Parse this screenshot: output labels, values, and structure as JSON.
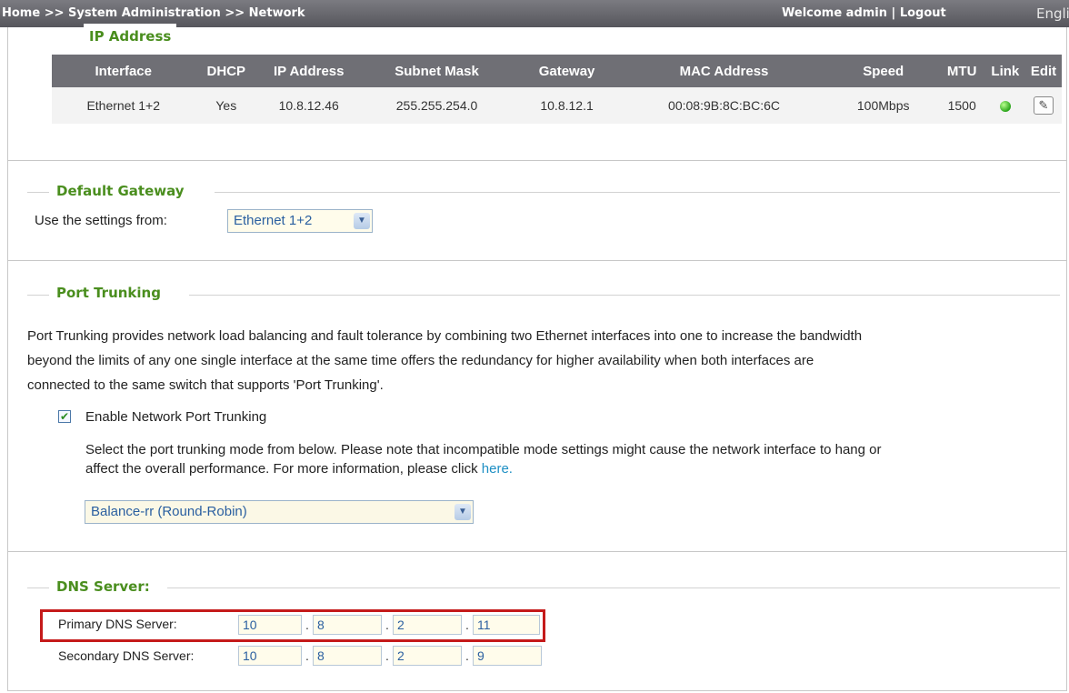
{
  "topbar": {
    "breadcrumb": [
      "Home",
      "System Administration",
      "Network"
    ],
    "separator": ">>",
    "welcome": "Welcome admin",
    "divider": "|",
    "logout": "Logout",
    "language": "English"
  },
  "ip_address": {
    "legend": "IP Address",
    "columns": [
      "Interface",
      "DHCP",
      "IP Address",
      "Subnet Mask",
      "Gateway",
      "MAC Address",
      "Speed",
      "MTU",
      "Link",
      "Edit"
    ],
    "row": {
      "interface": "Ethernet 1+2",
      "dhcp": "Yes",
      "ip": "10.8.12.46",
      "subnet": "255.255.254.0",
      "gateway": "10.8.12.1",
      "mac": "00:08:9B:8C:BC:6C",
      "speed": "100Mbps",
      "mtu": "1500",
      "link_status": "up",
      "link_color": "#2aa51a",
      "edit_icon": "edit-icon"
    }
  },
  "default_gateway": {
    "legend": "Default Gateway",
    "label": "Use the settings from:",
    "selected": "Ethernet 1+2"
  },
  "port_trunking": {
    "legend": "Port Trunking",
    "description_1": "Port Trunking provides network load balancing and fault tolerance by combining two Ethernet interfaces into one to increase the bandwidth",
    "description_2": "beyond the limits of any one single interface at the same time offers the redundancy for higher availability when both interfaces are",
    "description_3": "connected to the same switch that supports 'Port Trunking'.",
    "enable_label": "Enable Network Port Trunking",
    "enable_checked": true,
    "mode_text_1": "Select the port trunking mode from below. Please note that incompatible mode settings might cause the network interface to hang or",
    "mode_text_2": "affect the overall performance. For more information, please click",
    "here_link": "here.",
    "mode_selected": "Balance-rr (Round-Robin)"
  },
  "dns": {
    "legend": "DNS Server:",
    "primary_label": "Primary DNS Server:",
    "primary": [
      "10",
      "8",
      "2",
      "11"
    ],
    "secondary_label": "Secondary DNS Server:",
    "secondary": [
      "10",
      "8",
      "2",
      "9"
    ],
    "separator": ".",
    "highlight_color": "#c51a1a"
  },
  "colors": {
    "accent_green": "#4a8e1e",
    "header_gray": "#6f6f75",
    "link_blue": "#1e8fc4"
  }
}
